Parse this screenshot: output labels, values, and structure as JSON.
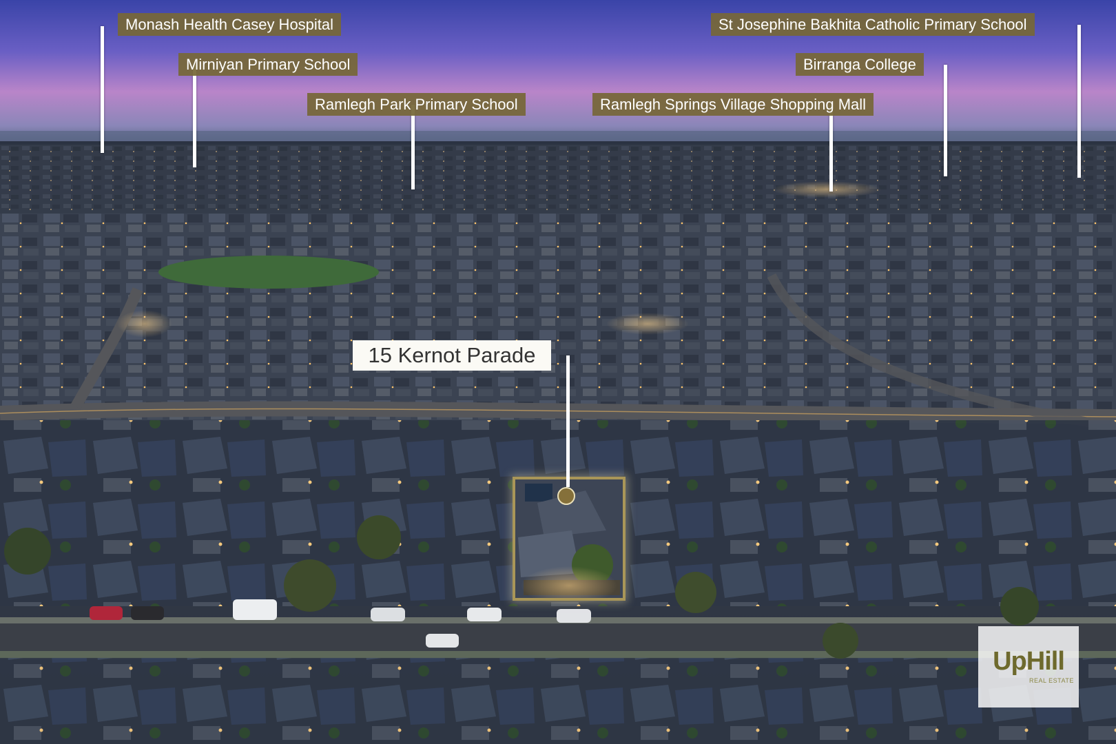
{
  "landmarks": [
    {
      "label": "Monash Health Casey Hospital"
    },
    {
      "label": "Mirniyan Primary School"
    },
    {
      "label": "Ramlegh Park Primary School"
    },
    {
      "label": "Ramlegh Springs Village Shopping Mall"
    },
    {
      "label": "Birranga College"
    },
    {
      "label": "St Josephine Bakhita Catholic Primary School"
    }
  ],
  "property": {
    "address": "15 Kernot Parade"
  },
  "brand": {
    "name_part1": "Up",
    "name_part2": "Hill",
    "tagline": "REAL ESTATE"
  },
  "colors": {
    "label_bg": "#766738",
    "lot_outline": "#a99658",
    "brand": "#6e6a2d"
  }
}
